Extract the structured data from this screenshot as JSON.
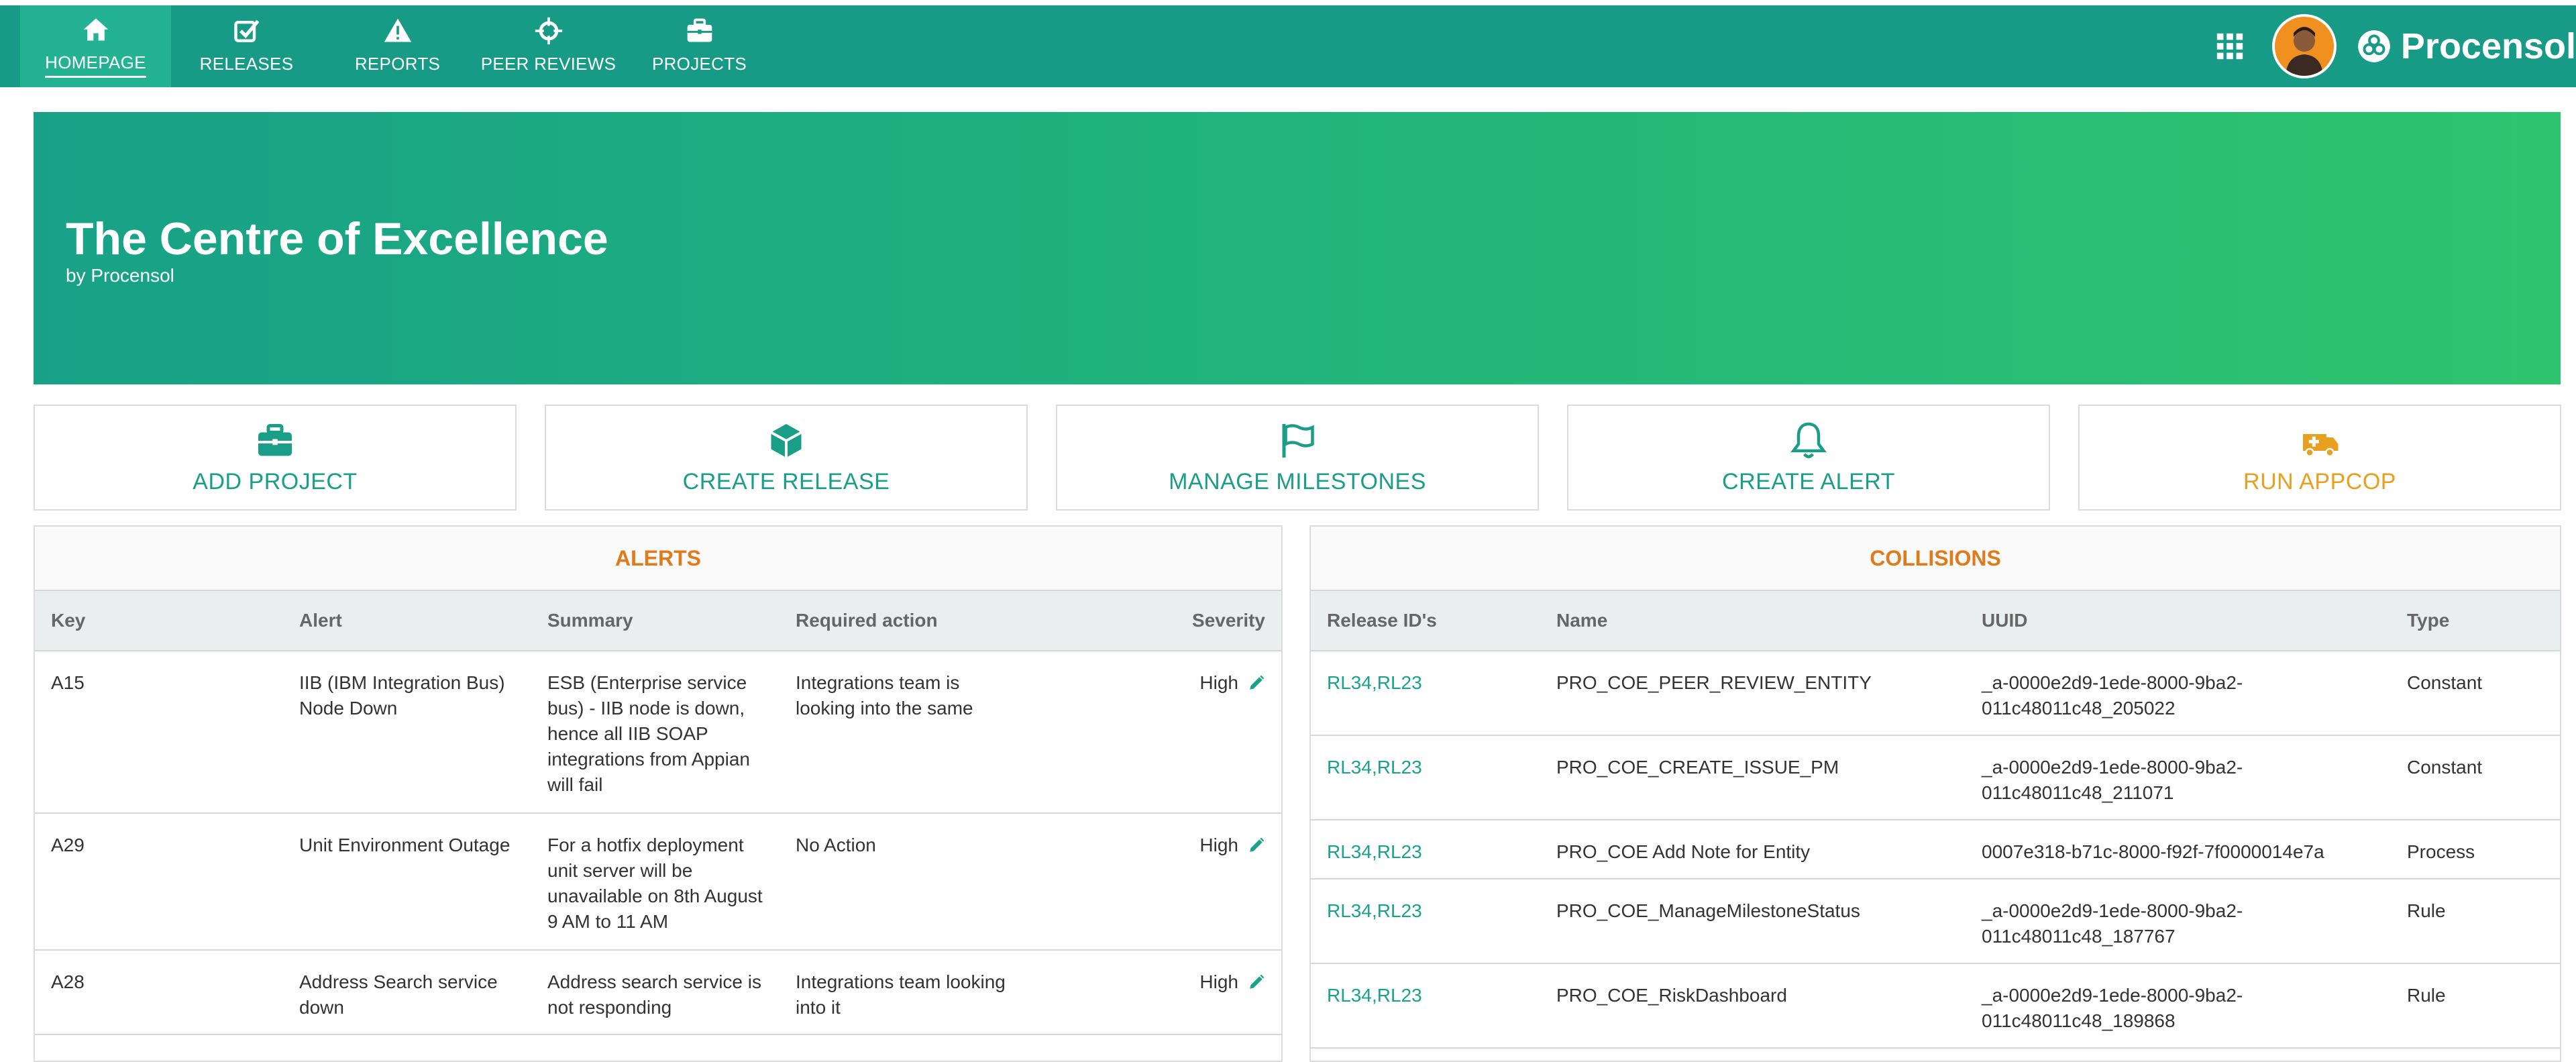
{
  "nav": {
    "items": [
      {
        "label": "HOMEPAGE",
        "icon": "home-icon"
      },
      {
        "label": "RELEASES",
        "icon": "checkbox-icon"
      },
      {
        "label": "REPORTS",
        "icon": "warning-icon"
      },
      {
        "label": "PEER REVIEWS",
        "icon": "crosshair-icon"
      },
      {
        "label": "PROJECTS",
        "icon": "briefcase-icon"
      }
    ],
    "active": "HOMEPAGE",
    "brand": "Procensol"
  },
  "hero": {
    "title": "The Centre of Excellence",
    "subtitle": "by Procensol"
  },
  "actions": [
    {
      "label": "ADD PROJECT",
      "icon": "briefcase-icon",
      "color": "#1a9e88"
    },
    {
      "label": "CREATE RELEASE",
      "icon": "cube-icon",
      "color": "#1a9e88"
    },
    {
      "label": "MANAGE MILESTONES",
      "icon": "flag-icon",
      "color": "#1a9e88"
    },
    {
      "label": "CREATE ALERT",
      "icon": "bell-icon",
      "color": "#1a9e88"
    },
    {
      "label": "RUN APPCOP",
      "icon": "ambulance-icon",
      "color": "#e9a020"
    }
  ],
  "alerts": {
    "title": "ALERTS",
    "columns": [
      "Key",
      "Alert",
      "Summary",
      "Required action",
      "Severity"
    ],
    "rows": [
      {
        "key": "A15",
        "alert": "IIB (IBM Integration Bus) Node Down",
        "summary": "ESB (Enterprise service bus) - IIB node is down, hence all IIB SOAP integrations from Appian will fail",
        "action": "Integrations team is looking into the same",
        "severity": "High"
      },
      {
        "key": "A29",
        "alert": "Unit Environment Outage",
        "summary": "For a hotfix deployment unit server will be unavailable on 8th August 9 AM to 11 AM",
        "action": "No Action",
        "severity": "High"
      },
      {
        "key": "A28",
        "alert": "Address Search service down",
        "summary": "Address search service is not responding",
        "action": "Integrations team looking into it",
        "severity": "High"
      }
    ]
  },
  "collisions": {
    "title": "COLLISIONS",
    "columns": [
      "Release ID's",
      "Name",
      "UUID",
      "Type"
    ],
    "rows": [
      {
        "release": "RL34,RL23",
        "name": "PRO_COE_PEER_REVIEW_ENTITY",
        "uuid1": "_a-0000e2d9-1ede-8000-9ba2-",
        "uuid2": "011c48011c48_205022",
        "type": "Constant"
      },
      {
        "release": "RL34,RL23",
        "name": "PRO_COE_CREATE_ISSUE_PM",
        "uuid1": "_a-0000e2d9-1ede-8000-9ba2-",
        "uuid2": "011c48011c48_211071",
        "type": "Constant"
      },
      {
        "release": "RL34,RL23",
        "name": "PRO_COE Add Note for Entity",
        "uuid1": "0007e318-b71c-8000-f92f-7f0000014e7a",
        "uuid2": "",
        "type": "Process"
      },
      {
        "release": "RL34,RL23",
        "name": "PRO_COE_ManageMilestoneStatus",
        "uuid1": "_a-0000e2d9-1ede-8000-9ba2-",
        "uuid2": "011c48011c48_187767",
        "type": "Rule"
      },
      {
        "release": "RL34,RL23",
        "name": "PRO_COE_RiskDashboard",
        "uuid1": "_a-0000e2d9-1ede-8000-9ba2-",
        "uuid2": "011c48011c48_189868",
        "type": "Rule"
      }
    ]
  },
  "colors": {
    "topbar": "#179a86",
    "active_tab": "#23b393",
    "accent_orange": "#e07b1b",
    "link": "#1aa38a"
  }
}
